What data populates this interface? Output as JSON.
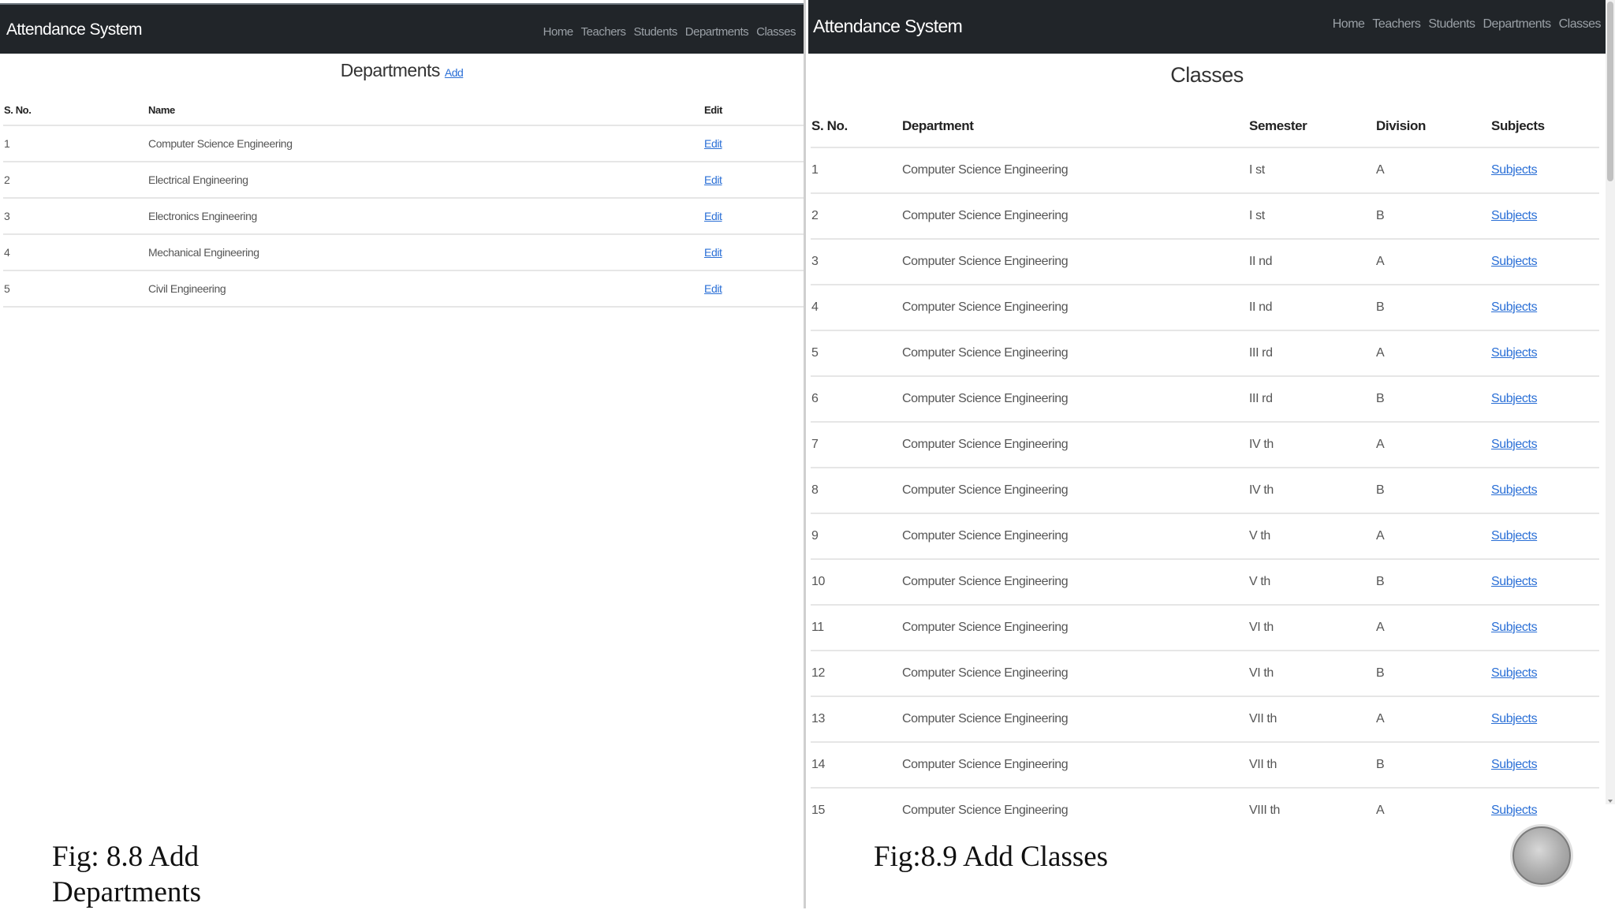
{
  "left": {
    "brand": "Attendance System",
    "nav": [
      "Home",
      "Teachers",
      "Students",
      "Departments",
      "Classes"
    ],
    "title": "Departments",
    "add_label": "Add",
    "columns": [
      "S. No.",
      "Name",
      "Edit"
    ],
    "rows": [
      {
        "sno": "1",
        "name": "Computer Science Engineering",
        "edit": "Edit"
      },
      {
        "sno": "2",
        "name": "Electrical Engineering",
        "edit": "Edit"
      },
      {
        "sno": "3",
        "name": "Electronics Engineering",
        "edit": "Edit"
      },
      {
        "sno": "4",
        "name": "Mechanical Engineering",
        "edit": "Edit"
      },
      {
        "sno": "5",
        "name": "Civil Engineering",
        "edit": "Edit"
      }
    ],
    "caption": "Fig: 8.8 Add Departments"
  },
  "right": {
    "brand": "Attendance System",
    "nav": [
      "Home",
      "Teachers",
      "Students",
      "Departments",
      "Classes"
    ],
    "title": "Classes",
    "columns": [
      "S. No.",
      "Department",
      "Semester",
      "Division",
      "Subjects"
    ],
    "rows": [
      {
        "sno": "1",
        "dept": "Computer Science Engineering",
        "sem": "I st",
        "div": "A",
        "subj": "Subjects"
      },
      {
        "sno": "2",
        "dept": "Computer Science Engineering",
        "sem": "I st",
        "div": "B",
        "subj": "Subjects"
      },
      {
        "sno": "3",
        "dept": "Computer Science Engineering",
        "sem": "II nd",
        "div": "A",
        "subj": "Subjects"
      },
      {
        "sno": "4",
        "dept": "Computer Science Engineering",
        "sem": "II nd",
        "div": "B",
        "subj": "Subjects"
      },
      {
        "sno": "5",
        "dept": "Computer Science Engineering",
        "sem": "III rd",
        "div": "A",
        "subj": "Subjects"
      },
      {
        "sno": "6",
        "dept": "Computer Science Engineering",
        "sem": "III rd",
        "div": "B",
        "subj": "Subjects"
      },
      {
        "sno": "7",
        "dept": "Computer Science Engineering",
        "sem": "IV th",
        "div": "A",
        "subj": "Subjects"
      },
      {
        "sno": "8",
        "dept": "Computer Science Engineering",
        "sem": "IV th",
        "div": "B",
        "subj": "Subjects"
      },
      {
        "sno": "9",
        "dept": "Computer Science Engineering",
        "sem": "V th",
        "div": "A",
        "subj": "Subjects"
      },
      {
        "sno": "10",
        "dept": "Computer Science Engineering",
        "sem": "V th",
        "div": "B",
        "subj": "Subjects"
      },
      {
        "sno": "11",
        "dept": "Computer Science Engineering",
        "sem": "VI th",
        "div": "A",
        "subj": "Subjects"
      },
      {
        "sno": "12",
        "dept": "Computer Science Engineering",
        "sem": "VI th",
        "div": "B",
        "subj": "Subjects"
      },
      {
        "sno": "13",
        "dept": "Computer Science Engineering",
        "sem": "VII th",
        "div": "A",
        "subj": "Subjects"
      },
      {
        "sno": "14",
        "dept": "Computer Science Engineering",
        "sem": "VII th",
        "div": "B",
        "subj": "Subjects"
      },
      {
        "sno": "15",
        "dept": "Computer Science Engineering",
        "sem": "VIII th",
        "div": "A",
        "subj": "Subjects"
      }
    ],
    "caption": "Fig:8.9 Add Classes"
  },
  "colors": {
    "navbar": "#212529",
    "link": "#2a6fd6",
    "nav_text": "#9aa0a6"
  }
}
